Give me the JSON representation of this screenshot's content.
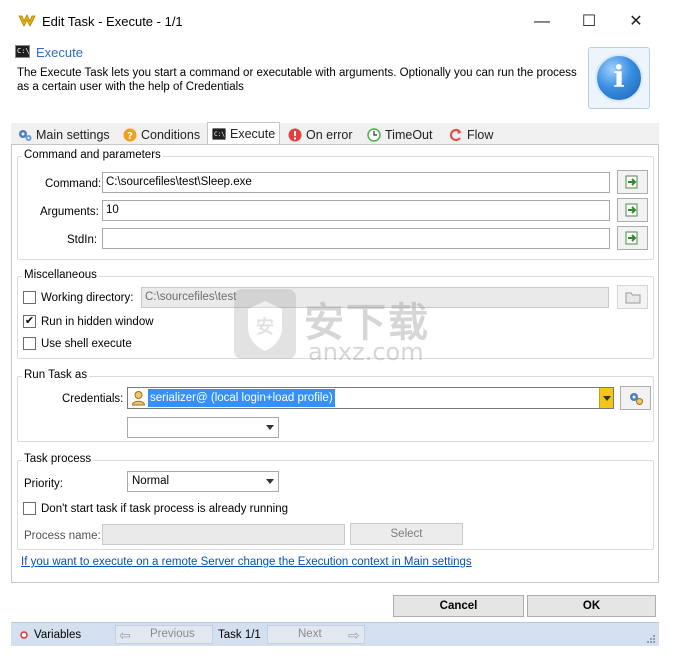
{
  "window": {
    "title": "Edit Task - Execute - 1/1",
    "minimize_glyph": "—",
    "maximize_glyph": "☐",
    "close_glyph": "✕"
  },
  "header": {
    "title": "Execute",
    "description": "The Execute Task lets you start a command or executable with arguments. Optionally you can run the process as a certain user with the help of Credentials",
    "info_glyph": "i"
  },
  "tabs": [
    {
      "label": "Main settings",
      "icon": "gears-icon",
      "color": "#4a7fc1"
    },
    {
      "label": "Conditions",
      "icon": "question-icon",
      "color": "#f0a020"
    },
    {
      "label": "Execute",
      "icon": "console-icon",
      "color": "#1e1e1e"
    },
    {
      "label": "On error",
      "icon": "error-icon",
      "color": "#e04040"
    },
    {
      "label": "TimeOut",
      "icon": "clock-icon",
      "color": "#4caf50"
    },
    {
      "label": "Flow",
      "icon": "flow-icon",
      "color": "#e05050"
    }
  ],
  "command_group": {
    "title": "Command and parameters",
    "command_label": "Command:",
    "command_value": "C:\\sourcefiles\\test\\Sleep.exe",
    "arguments_label": "Arguments:",
    "arguments_value": "10",
    "stdin_label": "StdIn:",
    "stdin_value": ""
  },
  "misc_group": {
    "title": "Miscellaneous",
    "working_dir_label": "Working directory:",
    "working_dir_value": "C:\\sourcefiles\\test",
    "working_dir_checked": false,
    "hidden_window_label": "Run in hidden window",
    "hidden_window_checked": true,
    "shell_execute_label": "Use shell execute",
    "shell_execute_checked": false,
    "check_glyph": "✔"
  },
  "run_as_group": {
    "title": "Run Task as",
    "credentials_label": "Credentials:",
    "credentials_value": "serializer@ (local login+load profile)",
    "second_select_value": ""
  },
  "task_process_group": {
    "title": "Task process",
    "priority_label": "Priority:",
    "priority_value": "Normal",
    "dont_start_label": "Don't start task if task process is already running",
    "dont_start_checked": false,
    "process_name_label": "Process name:",
    "process_name_value": "",
    "select_button": "Select"
  },
  "remote_link": "If you want to execute on a remote Server change the Execution context in Main settings",
  "buttons": {
    "cancel": "Cancel",
    "ok": "OK"
  },
  "statusbar": {
    "variables": "Variables",
    "previous": "Previous",
    "task_counter": "Task 1/1",
    "next": "Next"
  },
  "watermark": {
    "cn_text": "安下载",
    "site": "anxz.com"
  }
}
